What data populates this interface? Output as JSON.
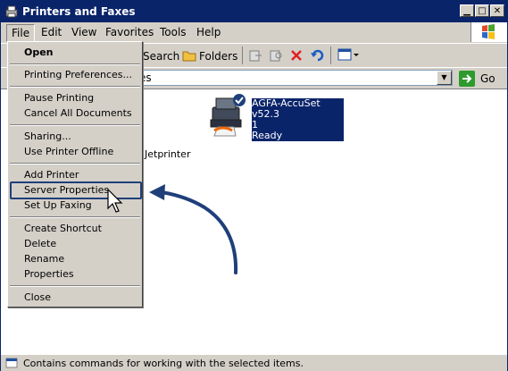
{
  "window": {
    "title": "Printers and Faxes"
  },
  "menubar": {
    "items": [
      "File",
      "Edit",
      "View",
      "Favorites",
      "Tools",
      "Help"
    ]
  },
  "toolbar": {
    "search_label": "Search",
    "folders_label": "Folders"
  },
  "address": {
    "value": "es",
    "go_label": "Go"
  },
  "file_menu": {
    "items": [
      "Open",
      "Printing Preferences...",
      "Pause Printing",
      "Cancel All Documents",
      "Sharing...",
      "Use Printer Offline",
      "Add Printer",
      "Server Properties",
      "Set Up Faxing",
      "Create Shortcut",
      "Delete",
      "Rename",
      "Properties",
      "Close"
    ]
  },
  "content": {
    "printer": {
      "name": "AGFA-AccuSet v52.3",
      "docs": "1",
      "status": "Ready"
    },
    "jetprinter_label": "Jetprinter"
  },
  "status": {
    "text": "Contains commands for working with the selected items."
  },
  "colors": {
    "titlebar": "#0a246a",
    "highlight_box": "#1f3f7a",
    "arrow": "#1f3f7a"
  }
}
